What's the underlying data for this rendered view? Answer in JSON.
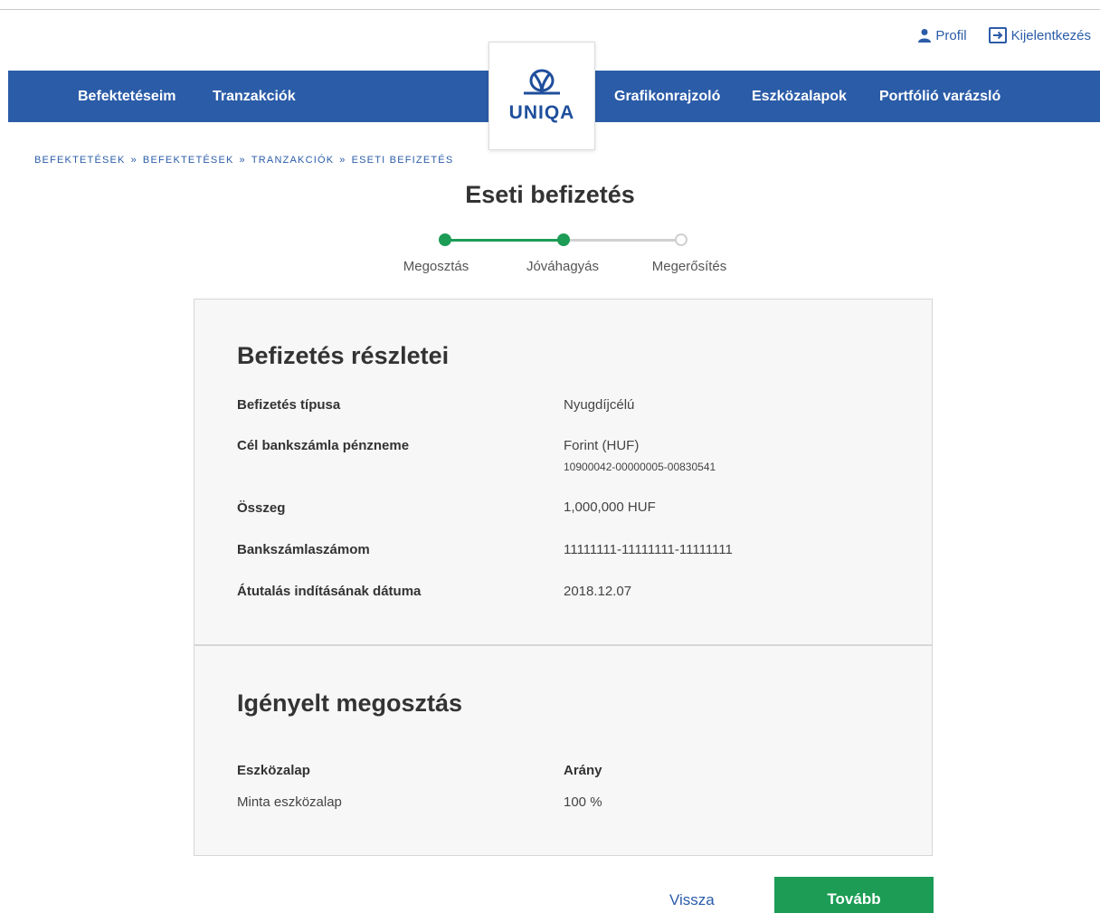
{
  "header": {
    "profile_label": "Profil",
    "logout_label": "Kijelentkezés",
    "logo_text": "UNIQA",
    "nav": [
      "Befektetéseim",
      "Tranzakciók",
      "Grafikonrajzoló",
      "Eszközalapok",
      "Portfólió varázsló"
    ]
  },
  "breadcrumb": [
    "BEFEKTETÉSEK",
    "BEFEKTETÉSEK",
    "TRANZAKCIÓK",
    "ESETI BEFIZETÉS"
  ],
  "breadcrumb_separator": "»",
  "page_title": "Eseti befizetés",
  "stepper": {
    "steps": [
      "Megosztás",
      "Jóváhagyás",
      "Megerősítés"
    ],
    "completed_steps": 2,
    "active_color": "#1c9c55",
    "inactive_color": "#d0d0d0"
  },
  "details": {
    "title": "Befizetés részletei",
    "rows": [
      {
        "label": "Befizetés típusa",
        "value": "Nyugdíjcélú"
      },
      {
        "label": "Cél bankszámla pénzneme",
        "value": "Forint (HUF)",
        "sub": "10900042-00000005-00830541"
      },
      {
        "label": "Összeg",
        "value": "1,000,000 HUF"
      },
      {
        "label": "Bankszámlaszámom",
        "value": "11111111-11111111-11111111"
      },
      {
        "label": "Átutalás indításának dátuma",
        "value": "2018.12.07"
      }
    ]
  },
  "allocation": {
    "title": "Igényelt megosztás",
    "col_fund": "Eszközalap",
    "col_ratio": "Arány",
    "rows": [
      {
        "fund": "Minta eszközalap",
        "ratio": "100 %"
      }
    ]
  },
  "actions": {
    "back_label": "Vissza",
    "next_label": "Tovább"
  },
  "colors": {
    "brand_blue": "#2b5ca8",
    "primary_green": "#1c9c55"
  }
}
